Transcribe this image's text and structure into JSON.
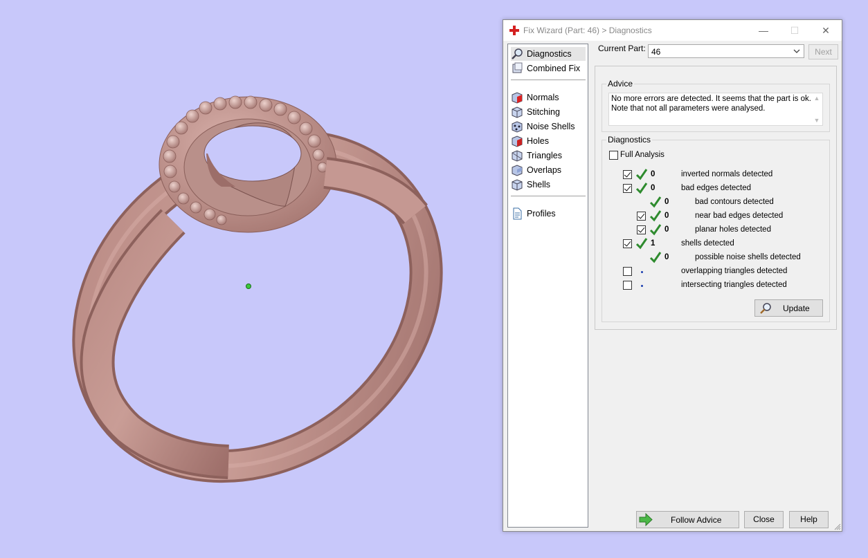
{
  "window": {
    "title": "Fix Wizard (Part: 46) > Diagnostics",
    "minimize_glyph": "—",
    "maximize_glyph": "☐",
    "close_glyph": "✕"
  },
  "sidebar": {
    "items": [
      {
        "label": "Diagnostics",
        "icon": "magnifier-icon",
        "active": true
      },
      {
        "label": "Combined Fix",
        "icon": "combined-fix-icon"
      },
      {
        "label": "Normals",
        "icon": "normals-cube-icon"
      },
      {
        "label": "Stitching",
        "icon": "stitching-cube-icon"
      },
      {
        "label": "Noise Shells",
        "icon": "noise-shells-cube-icon"
      },
      {
        "label": "Holes",
        "icon": "holes-cube-icon"
      },
      {
        "label": "Triangles",
        "icon": "triangles-cube-icon"
      },
      {
        "label": "Overlaps",
        "icon": "overlaps-cube-icon"
      },
      {
        "label": "Shells",
        "icon": "shells-cube-icon"
      },
      {
        "label": "Profiles",
        "icon": "document-icon"
      }
    ]
  },
  "current_part": {
    "label": "Current Part:",
    "value": "46",
    "next_label": "Next"
  },
  "advice": {
    "legend": "Advice",
    "line1": "No more errors are detected. It seems that the part is ok.",
    "line2": "Note that not all parameters were analysed."
  },
  "diagnostics": {
    "legend": "Diagnostics",
    "full_analysis_label": "Full Analysis",
    "full_analysis_checked": false,
    "rows": [
      {
        "checkbox": true,
        "checked": true,
        "status": "ok",
        "count": "0",
        "label": "inverted normals detected",
        "indent": 0
      },
      {
        "checkbox": true,
        "checked": true,
        "status": "ok",
        "count": "0",
        "label": "bad edges detected",
        "indent": 0
      },
      {
        "checkbox": false,
        "status": "ok",
        "count": "0",
        "label": "bad contours detected",
        "indent": 1
      },
      {
        "checkbox": true,
        "checked": true,
        "status": "ok",
        "count": "0",
        "label": "near bad edges detected",
        "indent": 1
      },
      {
        "checkbox": true,
        "checked": true,
        "status": "ok",
        "count": "0",
        "label": "planar holes detected",
        "indent": 1
      },
      {
        "checkbox": true,
        "checked": true,
        "status": "ok",
        "count": "1",
        "label": "shells detected",
        "indent": 0
      },
      {
        "checkbox": false,
        "status": "ok",
        "count": "0",
        "label": "possible noise shells detected",
        "indent": 1
      },
      {
        "checkbox": true,
        "checked": false,
        "status": "not-run",
        "count": "",
        "label": "overlapping triangles detected",
        "indent": 0
      },
      {
        "checkbox": true,
        "checked": false,
        "status": "not-run",
        "count": "",
        "label": "intersecting triangles detected",
        "indent": 0
      }
    ],
    "update_label": "Update"
  },
  "footer": {
    "follow_advice_label": "Follow Advice",
    "close_label": "Close",
    "help_label": "Help"
  },
  "colors": {
    "viewport_bg": "#c8c8fa",
    "model": "#c89690",
    "check_green": "#2e8b2e"
  }
}
